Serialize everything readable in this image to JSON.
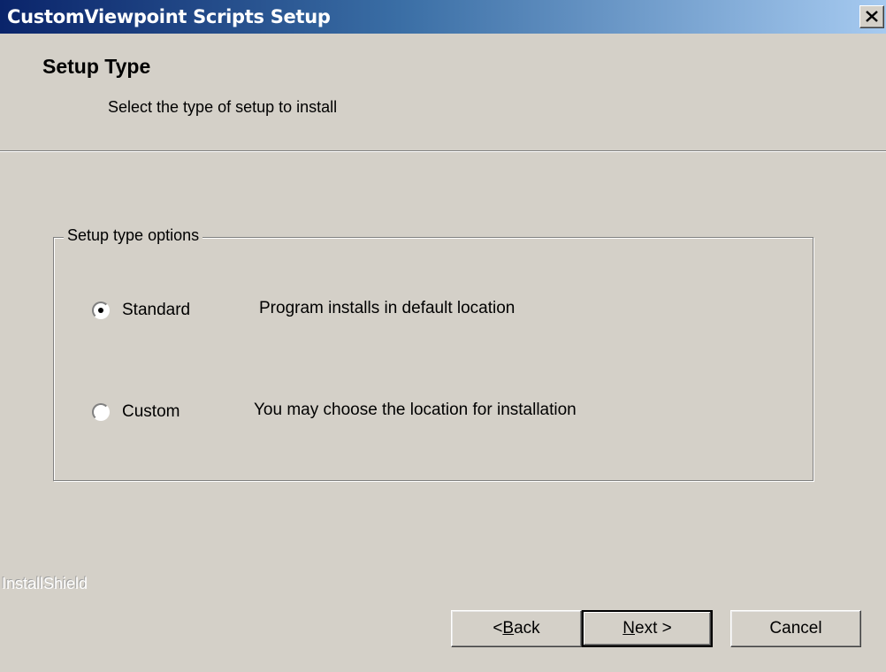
{
  "window": {
    "title": "CustomViewpoint Scripts Setup",
    "close_icon": "close-icon"
  },
  "header": {
    "title": "Setup Type",
    "subtitle": "Select the type of setup to install"
  },
  "group": {
    "label": "Setup type options",
    "options": [
      {
        "label": "Standard",
        "description": "Program installs in default location",
        "selected": true
      },
      {
        "label": "Custom",
        "description": "You may choose the location for installation",
        "selected": false
      }
    ]
  },
  "watermark": "InstallShield",
  "buttons": {
    "back_prefix": "< ",
    "back_mnemonic": "B",
    "back_rest": "ack",
    "next_mnemonic": "N",
    "next_rest": "ext >",
    "cancel": "Cancel"
  }
}
